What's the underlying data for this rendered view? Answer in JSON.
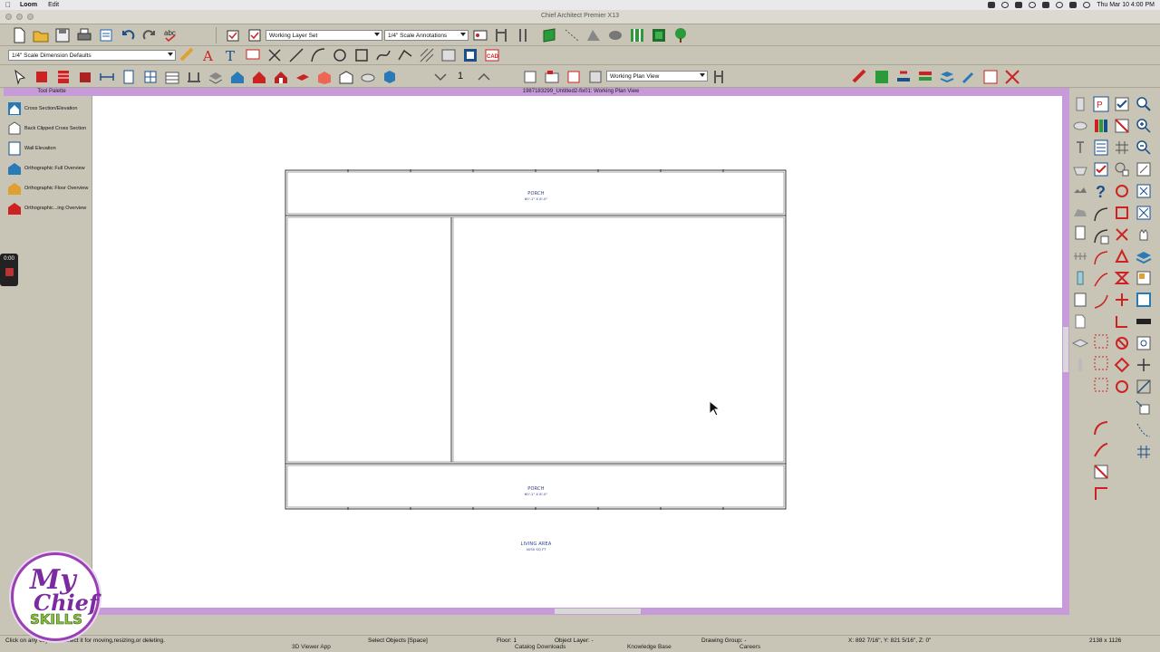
{
  "menubar": {
    "app_name": "Loom",
    "edit": "Edit",
    "clock": "Thu Mar 10  4:00 PM"
  },
  "window": {
    "title": "Chief Architect Premier X13"
  },
  "toolbar": {
    "layer_set": "Working Layer Set",
    "annotation_set": "1/4\" Scale Annotations",
    "dimension_defaults": "1/4\" Scale Dimension Defaults",
    "floor_number": "1",
    "plan_view": "Working Plan View"
  },
  "tool_palette": {
    "title": "Tool Palette",
    "items": [
      {
        "label": "Cross Section/Elevation",
        "icon": "cross-section-icon"
      },
      {
        "label": "Back Clipped Cross Section",
        "icon": "back-clipped-icon"
      },
      {
        "label": "Wall Elevation",
        "icon": "wall-elevation-icon"
      },
      {
        "label": "Orthographic Full Overview",
        "icon": "ortho-full-icon"
      },
      {
        "label": "Orthographic Floor Overview",
        "icon": "ortho-floor-icon"
      },
      {
        "label": "Orthographic...ing Overview",
        "icon": "ortho-framing-icon"
      }
    ]
  },
  "recorder": {
    "time": "0:00"
  },
  "view": {
    "title": "1987183299_Untitled2-fix01:  Working Plan View"
  },
  "plan": {
    "rooms": [
      {
        "name": "PORCH",
        "dims": "60'-1\" X 8'-0\""
      },
      {
        "name": "PORCH",
        "dims": "60'-1\" X 8'-0\""
      },
      {
        "name": "LIVING AREA",
        "dims": "4050 SQ FT"
      }
    ]
  },
  "status": {
    "hint": "Click on any object to select it for moving,resizing,or deleting.",
    "mode": "Select Objects [Space]",
    "floor": "Floor: 1",
    "object_layer": "Object Layer: -",
    "drawing_group": "Drawing Group: -",
    "coords": "X: 892 7/16\", Y: 821 5/16\", Z: 0\"",
    "size": "2138 x 1126"
  },
  "dock": {
    "items": [
      "3D Viewer App",
      "Catalog Downloads",
      "Knowledge Base",
      "Careers"
    ]
  },
  "logo": {
    "line1": "My",
    "line2": "Chief",
    "line3": "SKILLS"
  },
  "colors": {
    "accent_purple": "#c79bd9",
    "toolbar_bg": "#c8c4b6",
    "label_blue": "#2d3f88"
  }
}
